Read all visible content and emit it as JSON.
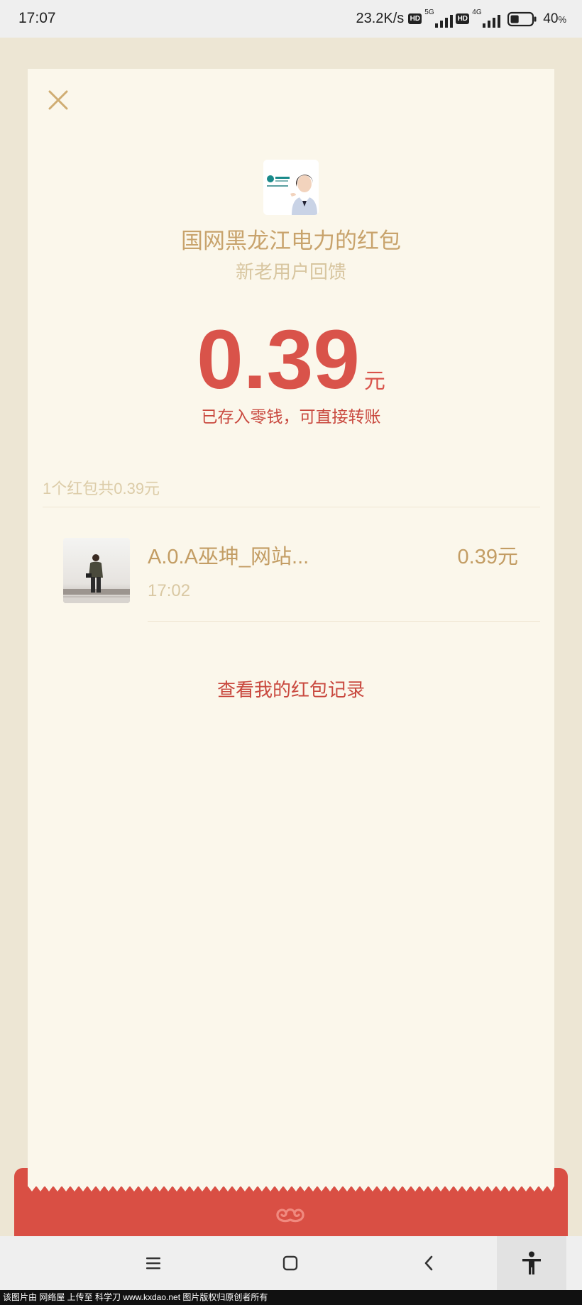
{
  "status_bar": {
    "time": "17:07",
    "net_speed": "23.2K/s",
    "hd_badge_1": "HD",
    "network_1": "5G",
    "hd_badge_2": "HD",
    "network_2": "4G",
    "battery_value": "40",
    "battery_unit": "%",
    "battery_level": 0.4,
    "icons": [
      "hd-badge-icon",
      "signal-5g-icon",
      "signal-4g-icon",
      "battery-icon"
    ]
  },
  "header": {
    "close_icon": "close-icon",
    "sender_logo_icon": "state-grid-logo",
    "sender_title": "国网黑龙江电力的红包",
    "greeting": "新老用户回馈"
  },
  "amount": {
    "value": "0.39",
    "unit": "元",
    "note": "已存入零钱，可直接转账"
  },
  "summary": "1个红包共0.39元",
  "receivers": [
    {
      "name": "A.0.A巫坤_网站...",
      "time": "17:02",
      "amount": "0.39元",
      "avatar_icon": "user-photo-avatar"
    }
  ],
  "records_link": "查看我的红包记录",
  "envelope": {
    "emblem_icon": "auspicious-cloud-icon"
  },
  "nav": {
    "menu_icon": "menu-icon",
    "home_icon": "home-square-icon",
    "back_icon": "back-chevron-icon",
    "accessibility_icon": "accessibility-icon"
  },
  "watermark": "该图片由 网络屋 上传至 科学刀 www.kxdao.net 图片版权归原创者所有",
  "colors": {
    "page_bg": "#ede6d4",
    "card_bg": "#fbf7eb",
    "gold_text": "#c8a36c",
    "amount_red": "#d9534a",
    "envelope_red": "#d94f44"
  }
}
